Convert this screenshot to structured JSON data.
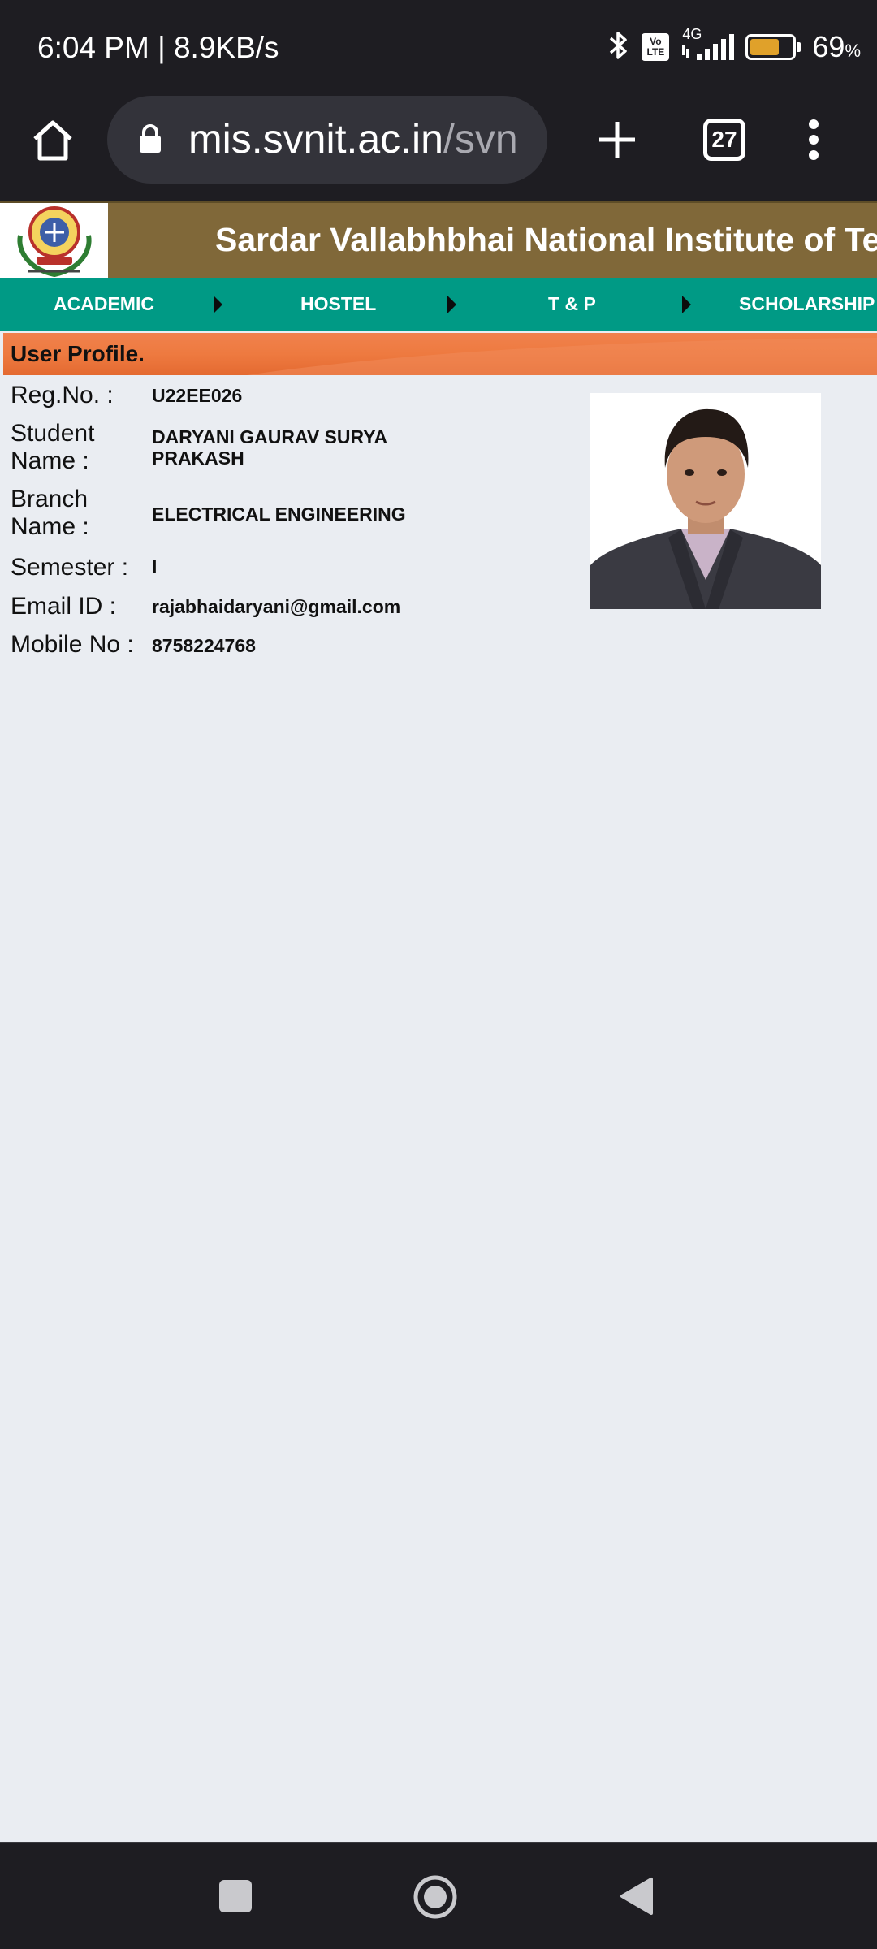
{
  "status_bar": {
    "time_speed": "6:04 PM | 8.9KB/s",
    "network": "4G",
    "volte": "Vo LTE",
    "battery_percent": "69",
    "battery_unit": "%",
    "battery_level": 0.69,
    "icons": [
      "bluetooth-icon",
      "volte-icon",
      "signal-icon",
      "battery-icon"
    ]
  },
  "browser": {
    "url_host": "mis.svnit.ac.in",
    "url_path": "/svn",
    "tab_count": "27",
    "icons": [
      "home-icon",
      "lock-icon",
      "plus-icon",
      "tabs-icon",
      "more-icon"
    ]
  },
  "site": {
    "title": "Sardar Vallabhbhai National Institute of Tech",
    "logo": "svnit-logo"
  },
  "nav": {
    "items": [
      "ACADEMIC",
      "HOSTEL",
      "T & P",
      "SCHOLARSHIP"
    ]
  },
  "profile": {
    "heading": "User Profile.",
    "fields": [
      {
        "label": "Reg.No. :",
        "value": "U22EE026"
      },
      {
        "label": "Student Name :",
        "value": "DARYANI GAURAV SURYA PRAKASH"
      },
      {
        "label": "Branch Name :",
        "value": "ELECTRICAL ENGINEERING"
      },
      {
        "label": "Semester :",
        "value": "I"
      },
      {
        "label": "Email ID :",
        "value": "rajabhaidaryani@gmail.com"
      },
      {
        "label": "Mobile No :",
        "value": "8758224768"
      }
    ]
  },
  "colors": {
    "status_bar_bg": "#1e1d22",
    "header_bg": "#806839",
    "nav_bg": "#009a85",
    "profile_header_bg": "#ee7a40",
    "page_bg": "#eaedf2"
  }
}
